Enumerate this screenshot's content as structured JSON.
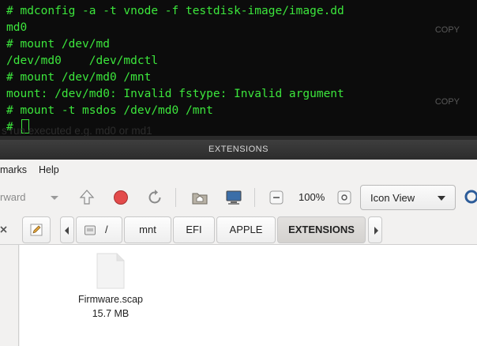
{
  "terminal": {
    "lines": [
      "# mdconfig -a -t vnode -f testdisk-image/image.dd",
      "md0",
      "# mount /dev/md",
      "/dev/md0    /dev/mdctl",
      "# mount /dev/md0 /mnt",
      "mount: /dev/md0: Invalid fstype: Invalid argument",
      "# mount -t msdos /dev/md0 /mnt",
      "# "
    ],
    "copy_label": "COPY",
    "overlay_text": "s run executed e.g. md0 or md1"
  },
  "window": {
    "title": "EXTENSIONS"
  },
  "menubar": {
    "items": [
      "marks",
      "Help"
    ]
  },
  "toolbar": {
    "forward_label": "rward",
    "zoom_level": "100%",
    "view_mode": "Icon View"
  },
  "pathbar": {
    "root_label": "/",
    "crumbs": [
      "mnt",
      "EFI",
      "APPLE",
      "EXTENSIONS"
    ]
  },
  "files": [
    {
      "name": "Firmware.scap",
      "size": "15.7 MB"
    }
  ],
  "colors": {
    "terminal_bg": "#0c0c0c",
    "terminal_fg": "#3ce63c",
    "titlebar": "#2c2c2c",
    "window_bg": "#f2f1f0"
  }
}
